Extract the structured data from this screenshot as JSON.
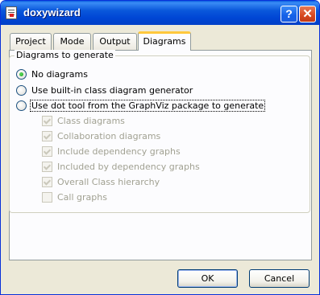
{
  "window": {
    "title": "doxywizard"
  },
  "titlebar": {
    "help_glyph": "?",
    "close_glyph": "✕"
  },
  "tabs": [
    {
      "label": "Project"
    },
    {
      "label": "Mode"
    },
    {
      "label": "Output"
    },
    {
      "label": "Diagrams",
      "active": true
    }
  ],
  "group": {
    "legend": "Diagrams to generate"
  },
  "radios": [
    {
      "label": "No diagrams",
      "checked": true
    },
    {
      "label": "Use built-in class diagram generator",
      "checked": false
    },
    {
      "label": "Use dot tool from the GraphViz package to generate",
      "checked": false,
      "focused": true
    }
  ],
  "checks": [
    {
      "label": "Class diagrams",
      "checked": true,
      "disabled": true
    },
    {
      "label": "Collaboration diagrams",
      "checked": true,
      "disabled": true
    },
    {
      "label": "Include dependency graphs",
      "checked": true,
      "disabled": true
    },
    {
      "label": "Included by dependency graphs",
      "checked": true,
      "disabled": true
    },
    {
      "label": "Overall Class hierarchy",
      "checked": true,
      "disabled": true
    },
    {
      "label": "Call graphs",
      "checked": false,
      "disabled": true
    }
  ],
  "buttons": {
    "ok": "OK",
    "cancel": "Cancel"
  },
  "colors": {
    "title_bar": "#0054e3",
    "face": "#ece9d8",
    "focus_tab": "#ffc83c",
    "disabled_text": "#a1a192"
  }
}
